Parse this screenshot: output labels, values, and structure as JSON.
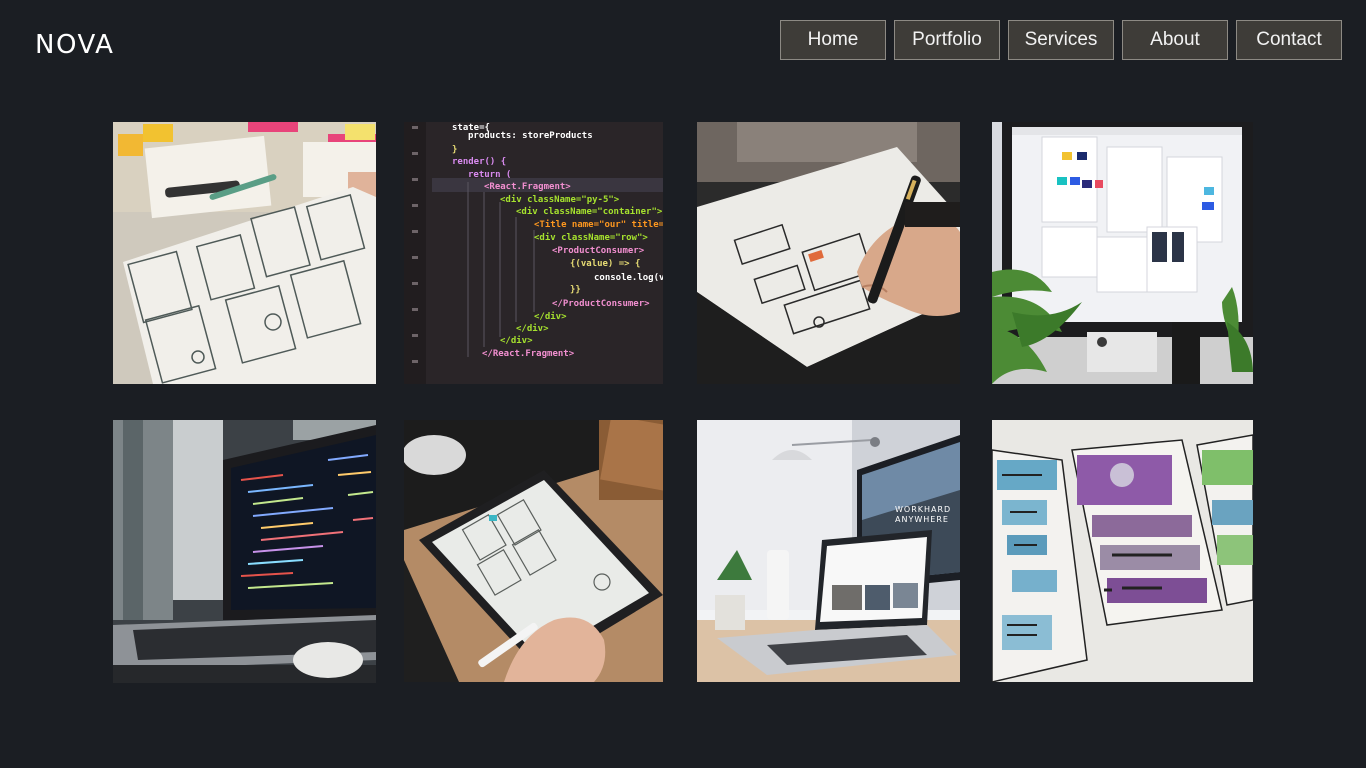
{
  "header": {
    "brand": "NOVA",
    "nav": [
      "Home",
      "Portfolio",
      "Services",
      "About",
      "Contact"
    ]
  },
  "code_snippet": {
    "lines": [
      "state={",
      "products: storeProducts",
      "}",
      "render() {",
      "return (",
      "<React.Fragment>",
      "<div className=\"py-5\">",
      "<div className=\"container\">",
      "<Title name=\"our\" title=\"",
      "<div className=\"row\">",
      "<ProductConsumer>",
      "{(value) => {",
      "console.log(va",
      "}}",
      "</ProductConsumer>",
      "</div>",
      "</div>",
      "</div>",
      "</React.Fragment>"
    ]
  },
  "monitor_texts": [
    "WORKHARD",
    "ANYWHERE"
  ],
  "colors": {
    "background": "#1b1e23",
    "nav_bg": "#3e3c38",
    "nav_border": "#8d8a84"
  }
}
